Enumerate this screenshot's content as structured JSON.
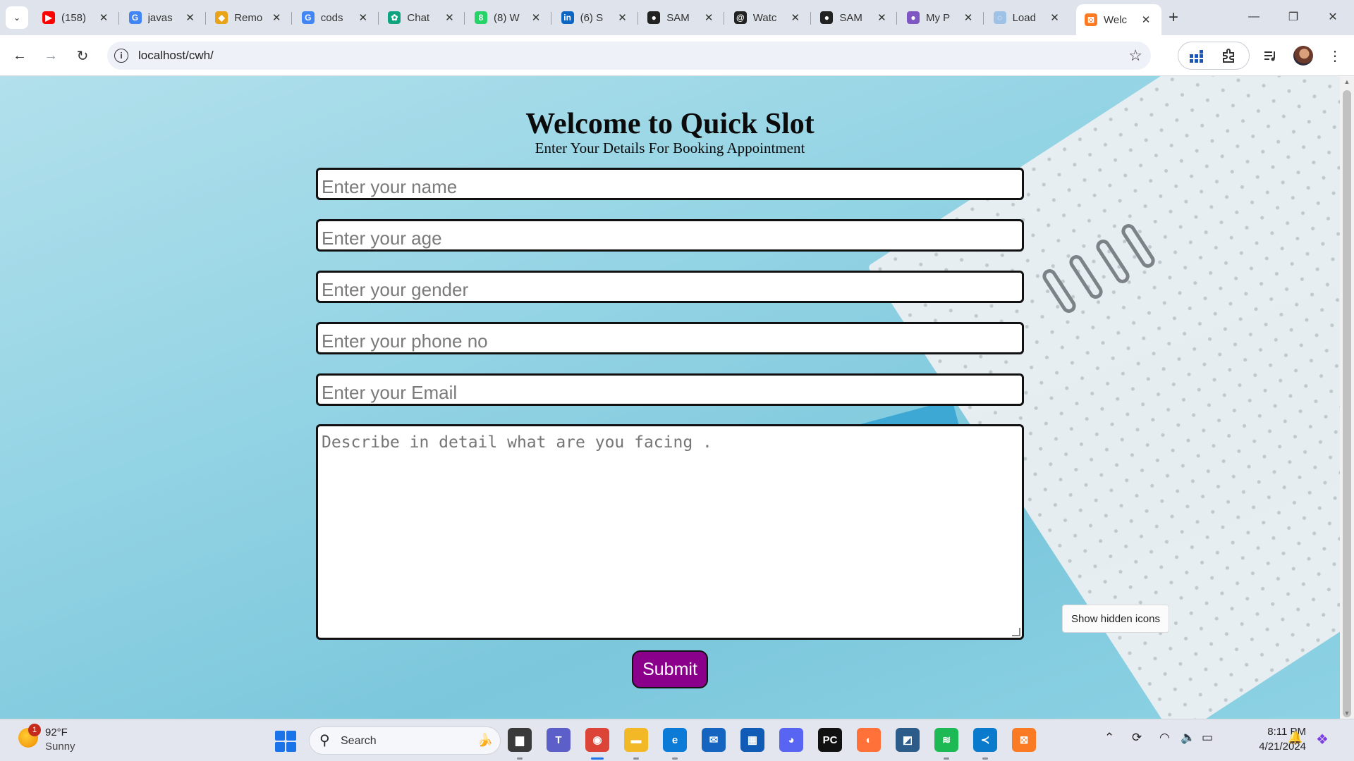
{
  "browser": {
    "tabs": [
      {
        "title": "(158)",
        "icon": "youtube-icon",
        "color": "#ff0000",
        "glyph": "▶"
      },
      {
        "title": "javas",
        "icon": "google-icon",
        "color": "#4285f4",
        "glyph": "G"
      },
      {
        "title": "Remo",
        "icon": "course-icon",
        "color": "#e8a317",
        "glyph": "◆"
      },
      {
        "title": "cods",
        "icon": "google-icon",
        "color": "#4285f4",
        "glyph": "G"
      },
      {
        "title": "Chat",
        "icon": "chatgpt-icon",
        "color": "#10a37f",
        "glyph": "✿"
      },
      {
        "title": "(8) W",
        "icon": "whatsapp-icon",
        "color": "#25d366",
        "glyph": "8"
      },
      {
        "title": "(6) S",
        "icon": "linkedin-icon",
        "color": "#0a66c2",
        "glyph": "in"
      },
      {
        "title": "SAM",
        "icon": "github-icon",
        "color": "#222222",
        "glyph": "●"
      },
      {
        "title": "Watc",
        "icon": "threads-icon",
        "color": "#222222",
        "glyph": "@"
      },
      {
        "title": "SAM",
        "icon": "github-icon",
        "color": "#222222",
        "glyph": "●"
      },
      {
        "title": "My P",
        "icon": "profile-icon",
        "color": "#7e57c2",
        "glyph": "●"
      },
      {
        "title": "Load",
        "icon": "loading-icon",
        "color": "#9ec2e6",
        "glyph": "◌"
      },
      {
        "title": "Welc",
        "icon": "xampp-icon",
        "color": "#fb7a24",
        "glyph": "⊠",
        "active": true
      }
    ],
    "close_glyph": "✕",
    "new_tab_glyph": "+",
    "window_controls": {
      "minimize": "—",
      "restore": "❐",
      "close": "✕"
    },
    "address": "localhost/cwh/",
    "nav": {
      "back": "←",
      "forward": "→",
      "reload": "↻"
    },
    "bookmark_glyph": "☆"
  },
  "page": {
    "title": "Welcome to Quick Slot",
    "subtitle": "Enter Your Details For Booking Appointment",
    "fields": [
      {
        "placeholder": "Enter your name"
      },
      {
        "placeholder": "Enter your age"
      },
      {
        "placeholder": "Enter your gender"
      },
      {
        "placeholder": "Enter your phone no"
      },
      {
        "placeholder": "Enter your Email"
      }
    ],
    "description_placeholder": "Describe in detail what are you facing .",
    "submit_label": "Submit",
    "accent_color": "#8b008b",
    "tooltip": "Show hidden icons"
  },
  "taskbar": {
    "weather_temp": "92°F",
    "weather_condition": "Sunny",
    "weather_badge": "1",
    "search_label": "Search",
    "apps": [
      {
        "name": "file-explorer-icon",
        "glyph": "▆",
        "color": "#3a3a3a"
      },
      {
        "name": "teams-icon",
        "glyph": "T",
        "color": "#5b5fc7"
      },
      {
        "name": "chrome-icon",
        "glyph": "◉",
        "color": "#db4437",
        "active": true
      },
      {
        "name": "folder-icon",
        "glyph": "▬",
        "color": "#f2b825"
      },
      {
        "name": "edge-icon",
        "glyph": "e",
        "color": "#0c7bd8"
      },
      {
        "name": "mail-icon",
        "glyph": "✉",
        "color": "#1565c0"
      },
      {
        "name": "store-icon",
        "glyph": "▦",
        "color": "#0f5bb5"
      },
      {
        "name": "discord-icon",
        "glyph": "◕",
        "color": "#5865f2"
      },
      {
        "name": "pycharm-icon",
        "glyph": "PC",
        "color": "#111111"
      },
      {
        "name": "firefox-icon",
        "glyph": "◐",
        "color": "#ff7139"
      },
      {
        "name": "mysql-workbench-icon",
        "glyph": "◩",
        "color": "#2c5c8a"
      },
      {
        "name": "spotify-icon",
        "glyph": "≋",
        "color": "#1db954"
      },
      {
        "name": "vscode-icon",
        "glyph": "≺",
        "color": "#0a7acc"
      },
      {
        "name": "xampp-icon",
        "glyph": "⊠",
        "color": "#fb7a24"
      }
    ],
    "time": "8:11 PM",
    "date": "4/21/2024"
  }
}
